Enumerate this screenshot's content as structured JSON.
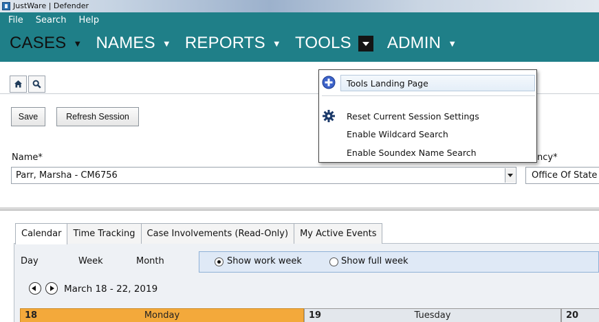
{
  "window": {
    "title": "JustWare | Defender"
  },
  "menubar": {
    "file": "File",
    "search": "Search",
    "help": "Help"
  },
  "nav": {
    "cases": "CASES",
    "names": "NAMES",
    "reports": "REPORTS",
    "tools": "TOOLS",
    "admin": "ADMIN"
  },
  "tools_menu": {
    "items": [
      {
        "label": "Tools Landing Page",
        "icon": "plus-circle-icon"
      },
      {
        "label": "Reset Current Session Settings",
        "icon": "gear-icon"
      },
      {
        "label": "Enable Wildcard Search"
      },
      {
        "label": "Enable Soundex Name Search"
      }
    ]
  },
  "toolbar": {
    "save": "Save",
    "refresh": "Refresh Session"
  },
  "form": {
    "name_label": "Name*",
    "name_value": "Parr, Marsha - CM6756",
    "agency_label": "ency*",
    "agency_value": "Office Of State"
  },
  "tabs": [
    "Calendar",
    "Time Tracking",
    "Case Involvements (Read-Only)",
    "My Active Events"
  ],
  "calendar": {
    "views": [
      "Day",
      "Week",
      "Month"
    ],
    "show_work_week": "Show work week",
    "show_full_week": "Show full week",
    "selected_week_option": "Show work week",
    "date_range": "March 18 - 22, 2019",
    "days": [
      {
        "num": "18",
        "name": "Monday"
      },
      {
        "num": "19",
        "name": "Tuesday"
      },
      {
        "num": "20",
        "name": ""
      }
    ]
  },
  "colors": {
    "teal": "#1f7f88",
    "today": "#f3a93b"
  }
}
